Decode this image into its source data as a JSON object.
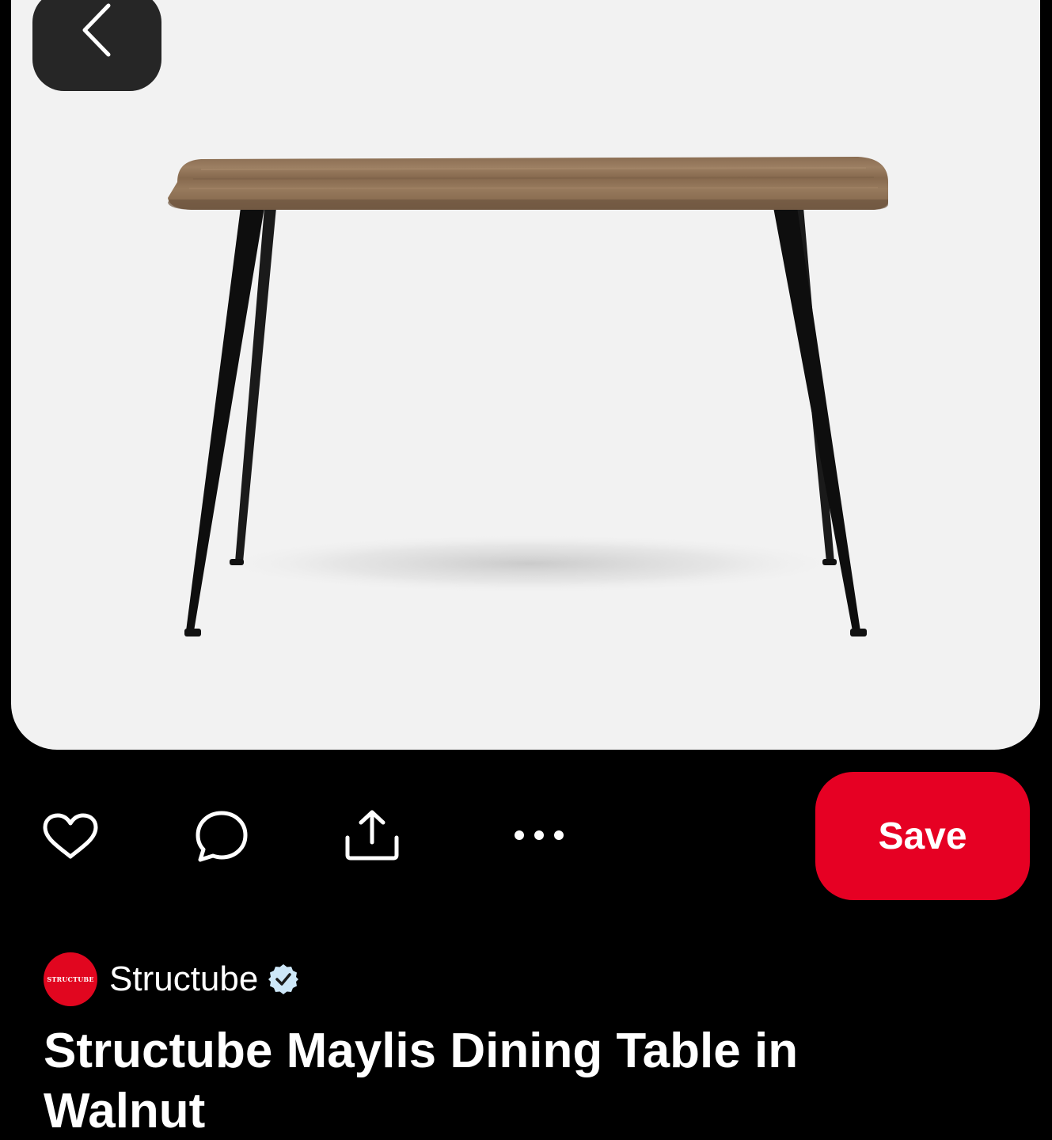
{
  "header": {
    "back_icon": "chevron-left-icon"
  },
  "product_image": {
    "subject": "wood-top dining table with black tapered legs",
    "background_color": "#f2f2f2"
  },
  "actions": {
    "like_icon": "heart-icon",
    "comment_icon": "comment-bubble-icon",
    "share_icon": "share-upload-icon",
    "more_icon": "more-dots-icon",
    "save_label": "Save",
    "save_color": "#e60023"
  },
  "creator": {
    "avatar_text": "STRUCTUBE",
    "avatar_color": "#e1061f",
    "name": "Structube",
    "verified_icon": "verified-check-icon",
    "verified_color": "#cde7f8"
  },
  "pin": {
    "title": "Structube Maylis Dining Table in Walnut"
  }
}
